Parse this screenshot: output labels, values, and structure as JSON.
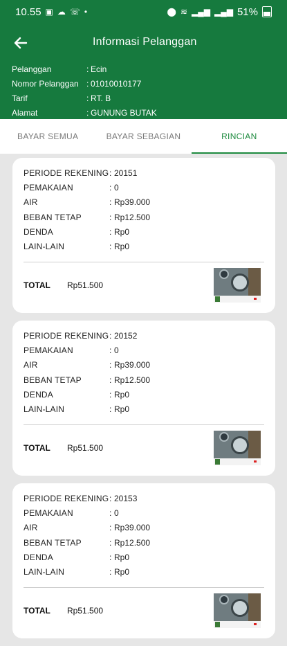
{
  "status_bar": {
    "time": "10.55",
    "battery": "51%"
  },
  "header": {
    "title": "Informasi Pelanggan"
  },
  "customer": [
    {
      "label": "Pelanggan",
      "value": "Ecin"
    },
    {
      "label": "Nomor Pelanggan",
      "value": "01010010177"
    },
    {
      "label": "Tarif",
      "value": "RT. B"
    },
    {
      "label": "Alamat",
      "value": "GUNUNG BUTAK"
    }
  ],
  "tabs": [
    {
      "label": "BAYAR SEMUA",
      "active": false
    },
    {
      "label": "BAYAR SEBAGIAN",
      "active": false
    },
    {
      "label": "RINCIAN",
      "active": true
    }
  ],
  "bills": [
    {
      "rows": [
        {
          "label": "PERIODE REKENING",
          "value": "20151"
        },
        {
          "label": "PEMAKAIAN",
          "value": "0"
        },
        {
          "label": "AIR",
          "value": "Rp39.000"
        },
        {
          "label": "BEBAN TETAP",
          "value": "Rp12.500"
        },
        {
          "label": "DENDA",
          "value": "Rp0"
        },
        {
          "label": "LAIN-LAIN",
          "value": "Rp0"
        }
      ],
      "total_label": "TOTAL",
      "total_value": "Rp51.500"
    },
    {
      "rows": [
        {
          "label": "PERIODE REKENING",
          "value": "20152"
        },
        {
          "label": "PEMAKAIAN",
          "value": "0"
        },
        {
          "label": "AIR",
          "value": "Rp39.000"
        },
        {
          "label": "BEBAN TETAP",
          "value": "Rp12.500"
        },
        {
          "label": "DENDA",
          "value": "Rp0"
        },
        {
          "label": "LAIN-LAIN",
          "value": "Rp0"
        }
      ],
      "total_label": "TOTAL",
      "total_value": "Rp51.500"
    },
    {
      "rows": [
        {
          "label": "PERIODE REKENING",
          "value": "20153"
        },
        {
          "label": "PEMAKAIAN",
          "value": "0"
        },
        {
          "label": "AIR",
          "value": "Rp39.000"
        },
        {
          "label": "BEBAN TETAP",
          "value": "Rp12.500"
        },
        {
          "label": "DENDA",
          "value": "Rp0"
        },
        {
          "label": "LAIN-LAIN",
          "value": "Rp0"
        }
      ],
      "total_label": "TOTAL",
      "total_value": "Rp51.500"
    }
  ],
  "colors": {
    "header_bg": "#167a3e",
    "accent": "#1d8a3e",
    "page_bg": "#e6e6e6"
  },
  "icons": {
    "back": "arrow-left-icon",
    "meter_photo": "meter-photo-thumbnail"
  }
}
